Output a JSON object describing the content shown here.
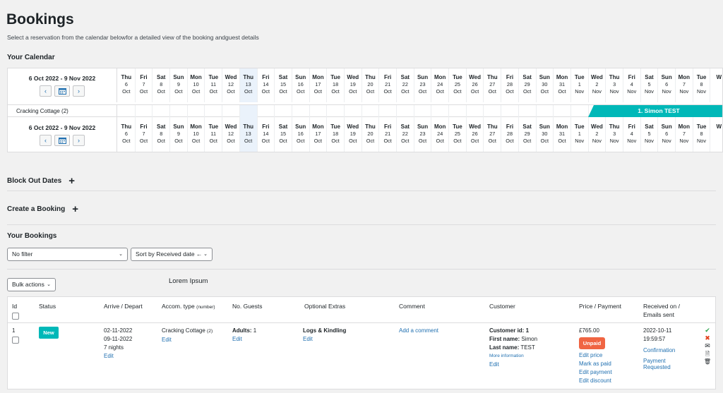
{
  "page": {
    "title": "Bookings",
    "subtitle": "Select a reservation from the calendar belowfor a detailed view of the booking andguest details"
  },
  "calendar": {
    "heading": "Your Calendar",
    "range": "6 Oct 2022 - 9 Nov 2022",
    "prev": "‹",
    "next": "›",
    "icon": "calendar-icon",
    "days": [
      [
        "Thu",
        "6",
        "Oct"
      ],
      [
        "Fri",
        "7",
        "Oct"
      ],
      [
        "Sat",
        "8",
        "Oct"
      ],
      [
        "Sun",
        "9",
        "Oct"
      ],
      [
        "Mon",
        "10",
        "Oct"
      ],
      [
        "Tue",
        "11",
        "Oct"
      ],
      [
        "Wed",
        "12",
        "Oct"
      ],
      [
        "Thu",
        "13",
        "Oct"
      ],
      [
        "Fri",
        "14",
        "Oct"
      ],
      [
        "Sat",
        "15",
        "Oct"
      ],
      [
        "Sun",
        "16",
        "Oct"
      ],
      [
        "Mon",
        "17",
        "Oct"
      ],
      [
        "Tue",
        "18",
        "Oct"
      ],
      [
        "Wed",
        "19",
        "Oct"
      ],
      [
        "Thu",
        "20",
        "Oct"
      ],
      [
        "Fri",
        "21",
        "Oct"
      ],
      [
        "Sat",
        "22",
        "Oct"
      ],
      [
        "Sun",
        "23",
        "Oct"
      ],
      [
        "Mon",
        "24",
        "Oct"
      ],
      [
        "Tue",
        "25",
        "Oct"
      ],
      [
        "Wed",
        "26",
        "Oct"
      ],
      [
        "Thu",
        "27",
        "Oct"
      ],
      [
        "Fri",
        "28",
        "Oct"
      ],
      [
        "Sat",
        "29",
        "Oct"
      ],
      [
        "Sun",
        "30",
        "Oct"
      ],
      [
        "Mon",
        "31",
        "Oct"
      ],
      [
        "Tue",
        "1",
        "Nov"
      ],
      [
        "Wed",
        "2",
        "Nov"
      ],
      [
        "Thu",
        "3",
        "Nov"
      ],
      [
        "Fri",
        "4",
        "Nov"
      ],
      [
        "Sat",
        "5",
        "Nov"
      ],
      [
        "Sun",
        "6",
        "Nov"
      ],
      [
        "Mon",
        "7",
        "Nov"
      ],
      [
        "Tue",
        "8",
        "Nov"
      ],
      [
        "W",
        "",
        ""
      ]
    ],
    "today_index": 7,
    "property": "Cracking Cottage (2)",
    "booking_label": "1. Simon TEST",
    "booking_color": "#00b8b8"
  },
  "sections": {
    "block_out": "Block Out Dates",
    "create": "Create a Booking",
    "your_bookings": "Your Bookings",
    "plus": "+"
  },
  "filters": {
    "filter": "No filter",
    "sort": "Sort by Received date ←",
    "bulk": "Bulk actions",
    "chevron": "⌄",
    "lorem": "Lorem Ipsum"
  },
  "table": {
    "headers": {
      "id": "Id",
      "status": "Status",
      "arrive": "Arrive / Depart",
      "accom": "Accom. type",
      "accom_small": "(number)",
      "guests": "No. Guests",
      "extras": "Optional Extras",
      "comment": "Comment",
      "customer": "Customer",
      "price": "Price / Payment",
      "received": "Received on /",
      "received2": "Emails sent"
    },
    "row": {
      "id": "1",
      "status": "New",
      "arrive": "02-11-2022",
      "depart": "09-11-2022",
      "nights": "7 nights",
      "edit": "Edit",
      "accom_name": "Cracking Cottage",
      "accom_num": "(2)",
      "guests_label": "Adults:",
      "guests_value": "1",
      "extras": "Logs & Kindling",
      "comment_link": "Add a comment",
      "cust_id_label": "Customer id:",
      "cust_id": "1",
      "first_label": "First name:",
      "first": "Simon",
      "last_label": "Last name:",
      "last": "TEST",
      "more_info": "More information",
      "price": "£765.00",
      "unpaid": "Unpaid",
      "edit_price": "Edit price",
      "mark_paid": "Mark as paid",
      "edit_payment": "Edit payment",
      "edit_discount": "Edit discount",
      "received_date": "2022-10-11",
      "received_time": "19:59:57",
      "confirmation": "Confirmation",
      "payment_req_1": "Payment",
      "payment_req_2": "Requested",
      "icons": {
        "approve": "✔",
        "cancel": "✖",
        "email": "✉",
        "document": "🗎",
        "trash": "🗑"
      },
      "colors": {
        "approve": "#2ea44f",
        "cancel": "#e2401c",
        "new": "#00b8b8",
        "unpaid": "#f06543",
        "link": "#2271b1"
      }
    }
  }
}
